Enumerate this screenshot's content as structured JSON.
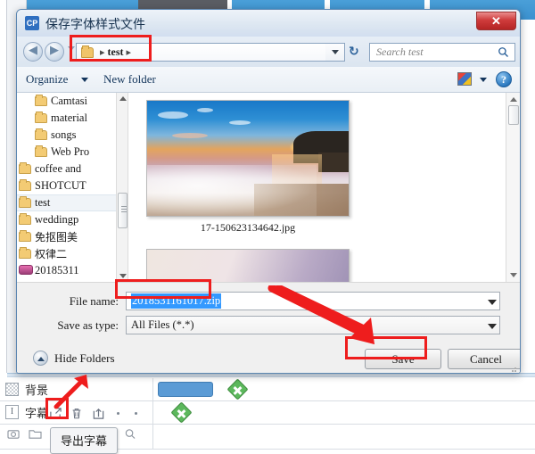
{
  "dialog": {
    "title": "保存字体样式文件",
    "app_icon": "CP",
    "close_label": "✕",
    "nav": {
      "back_icon": "◀",
      "forward_icon": "▶",
      "breadcrumb_sep_left": "▸",
      "breadcrumb_name": "test",
      "breadcrumb_sep_right": "▸",
      "refresh_icon": "↻",
      "search_placeholder": "Search test"
    },
    "commandbar": {
      "organize": "Organize",
      "new_folder": "New folder",
      "help": "?"
    },
    "navpane": {
      "items": [
        {
          "label": "Camtasi",
          "type": "folder",
          "indent": true,
          "selected": false
        },
        {
          "label": "material",
          "type": "folder",
          "indent": true,
          "selected": false
        },
        {
          "label": "songs",
          "type": "folder",
          "indent": true,
          "selected": false
        },
        {
          "label": "Web Pro",
          "type": "folder",
          "indent": true,
          "selected": false
        },
        {
          "label": "coffee and",
          "type": "folder",
          "indent": false,
          "selected": false
        },
        {
          "label": "SHOTCUT",
          "type": "folder",
          "indent": false,
          "selected": false
        },
        {
          "label": "test",
          "type": "folder",
          "indent": false,
          "selected": true
        },
        {
          "label": "weddingp",
          "type": "folder",
          "indent": false,
          "selected": false
        },
        {
          "label": "免抠图美",
          "type": "folder",
          "indent": false,
          "selected": false
        },
        {
          "label": "权律二",
          "type": "folder",
          "indent": false,
          "selected": false
        },
        {
          "label": "20185311",
          "type": "disc",
          "indent": false,
          "selected": false
        }
      ]
    },
    "filepane": {
      "files": [
        {
          "name": "17-150623134642.jpg"
        }
      ]
    },
    "footer": {
      "file_name_label": "File name:",
      "file_name_value": "2018531161017.zip",
      "save_type_label": "Save as type:",
      "save_type_value": "All Files (*.*)",
      "hide_folders": "Hide Folders",
      "save_button": "Save",
      "cancel_button": "Cancel"
    }
  },
  "timeline": {
    "tracks": [
      {
        "name": "背景"
      },
      {
        "name": "字幕"
      }
    ],
    "subtitle_tools": {
      "export_icon": "export-subtitle",
      "delete_icon": "delete-subtitle",
      "import_icon": "import-subtitle"
    },
    "tooltip": "导出字幕"
  }
}
